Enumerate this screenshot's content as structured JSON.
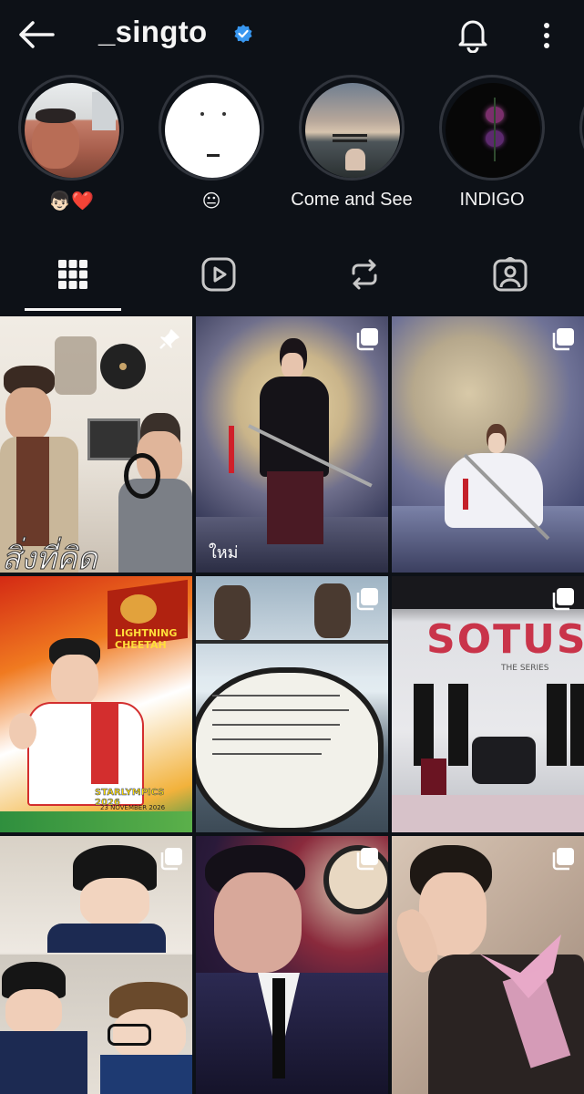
{
  "header": {
    "username": "_singto",
    "back_icon": "arrow-left-icon",
    "verified_icon": "verified-badge-icon",
    "notifications_icon": "bell-icon",
    "more_icon": "more-vertical-icon"
  },
  "stories": [
    {
      "label": "👦🏻❤️"
    },
    {
      "label": "😐"
    },
    {
      "label": "Come and See"
    },
    {
      "label": "INDIGO"
    }
  ],
  "tabs": [
    {
      "name": "posts",
      "icon": "grid-icon",
      "selected": true
    },
    {
      "name": "reels",
      "icon": "play-icon",
      "selected": false
    },
    {
      "name": "reposts",
      "icon": "repost-icon",
      "selected": false
    },
    {
      "name": "tagged",
      "icon": "tagged-user-icon",
      "selected": false
    }
  ],
  "posts": [
    {
      "type": "pinned",
      "overlay_text": "สิ่งที่คิด"
    },
    {
      "type": "carousel",
      "overlay_text": "ใหม่"
    },
    {
      "type": "carousel",
      "overlay_text": ""
    },
    {
      "type": "single",
      "overlay_text": "LIGHTNING CHEETAH",
      "subtext": "STARLYMPICS 2026",
      "date": "23 NOVEMBER 2026"
    },
    {
      "type": "carousel",
      "overlay_text": ""
    },
    {
      "type": "carousel",
      "overlay_text": "SOTUS",
      "subtext": "THE SERIES"
    },
    {
      "type": "carousel",
      "overlay_text": ""
    },
    {
      "type": "carousel",
      "overlay_text": ""
    },
    {
      "type": "carousel",
      "overlay_text": ""
    }
  ],
  "colors": {
    "background": "#0d1117",
    "text": "#f5f5f5",
    "verified": "#3897f0"
  }
}
